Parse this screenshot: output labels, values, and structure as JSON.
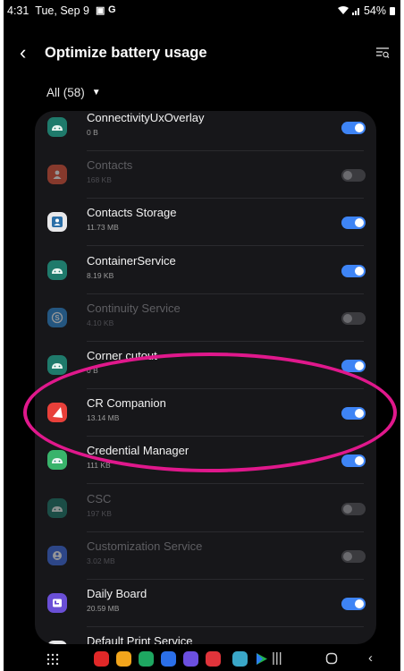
{
  "status": {
    "time": "4:31",
    "date": "Tue, Sep 9",
    "icon1": "▣",
    "icon2": "G",
    "battery": "54%"
  },
  "header": {
    "title": "Optimize battery usage"
  },
  "filter": {
    "label": "All (58)"
  },
  "apps": [
    {
      "name": "ConnectivityUxOverlay",
      "size": "0 B",
      "enabled": true,
      "icon": "android-icon",
      "color": "#1f7a6b"
    },
    {
      "name": "Contacts",
      "size": "168 KB",
      "enabled": false,
      "icon": "contacts-icon",
      "color": "#e2553c"
    },
    {
      "name": "Contacts Storage",
      "size": "11.73 MB",
      "enabled": true,
      "icon": "contacts-storage-icon",
      "color": "#e8e8ea"
    },
    {
      "name": "ContainerService",
      "size": "8.19 KB",
      "enabled": true,
      "icon": "android-icon",
      "color": "#1f7a6b"
    },
    {
      "name": "Continuity Service",
      "size": "4.10 KB",
      "enabled": false,
      "icon": "continuity-icon",
      "color": "#2f8bd4"
    },
    {
      "name": "Corner cutout",
      "size": "0 B",
      "enabled": true,
      "icon": "android-icon",
      "color": "#1f7a6b"
    },
    {
      "name": "CR Companion",
      "size": "13.14 MB",
      "enabled": true,
      "icon": "cr-companion-icon",
      "color": "#e8403a"
    },
    {
      "name": "Credential Manager",
      "size": "111 KB",
      "enabled": true,
      "icon": "android-icon",
      "color": "#39b36b"
    },
    {
      "name": "CSC",
      "size": "197 KB",
      "enabled": false,
      "icon": "android-icon",
      "color": "#1f7a6b"
    },
    {
      "name": "Customization Service",
      "size": "3.02 MB",
      "enabled": false,
      "icon": "customization-icon",
      "color": "#3f6ee0"
    },
    {
      "name": "Daily Board",
      "size": "20.59 MB",
      "enabled": true,
      "icon": "daily-board-icon",
      "color": "#6a4fd6"
    },
    {
      "name": "Default Print Service",
      "size": "",
      "enabled": true,
      "icon": "print-icon",
      "color": "#e8e8ea"
    }
  ],
  "colors": {
    "toggle_on": "#3e84f5",
    "annotation": "#e0188c",
    "card_bg": "#17171a"
  },
  "navbar": {
    "apps": [
      {
        "name": "app-grid-icon",
        "color": ""
      },
      {
        "name": "flipboard-icon",
        "color": "#e12828"
      },
      {
        "name": "notes-icon",
        "color": "#f2a51c"
      },
      {
        "name": "phone-icon",
        "color": "#1ea761"
      },
      {
        "name": "messages-icon",
        "color": "#2b6fe8"
      },
      {
        "name": "internet-icon",
        "color": "#6b4fe0"
      },
      {
        "name": "camera-icon",
        "color": "#e0343b"
      },
      {
        "name": "gallery-icon",
        "color": "#3aa7c8"
      },
      {
        "name": "play-store-icon",
        "color": "#ffffff"
      }
    ]
  }
}
